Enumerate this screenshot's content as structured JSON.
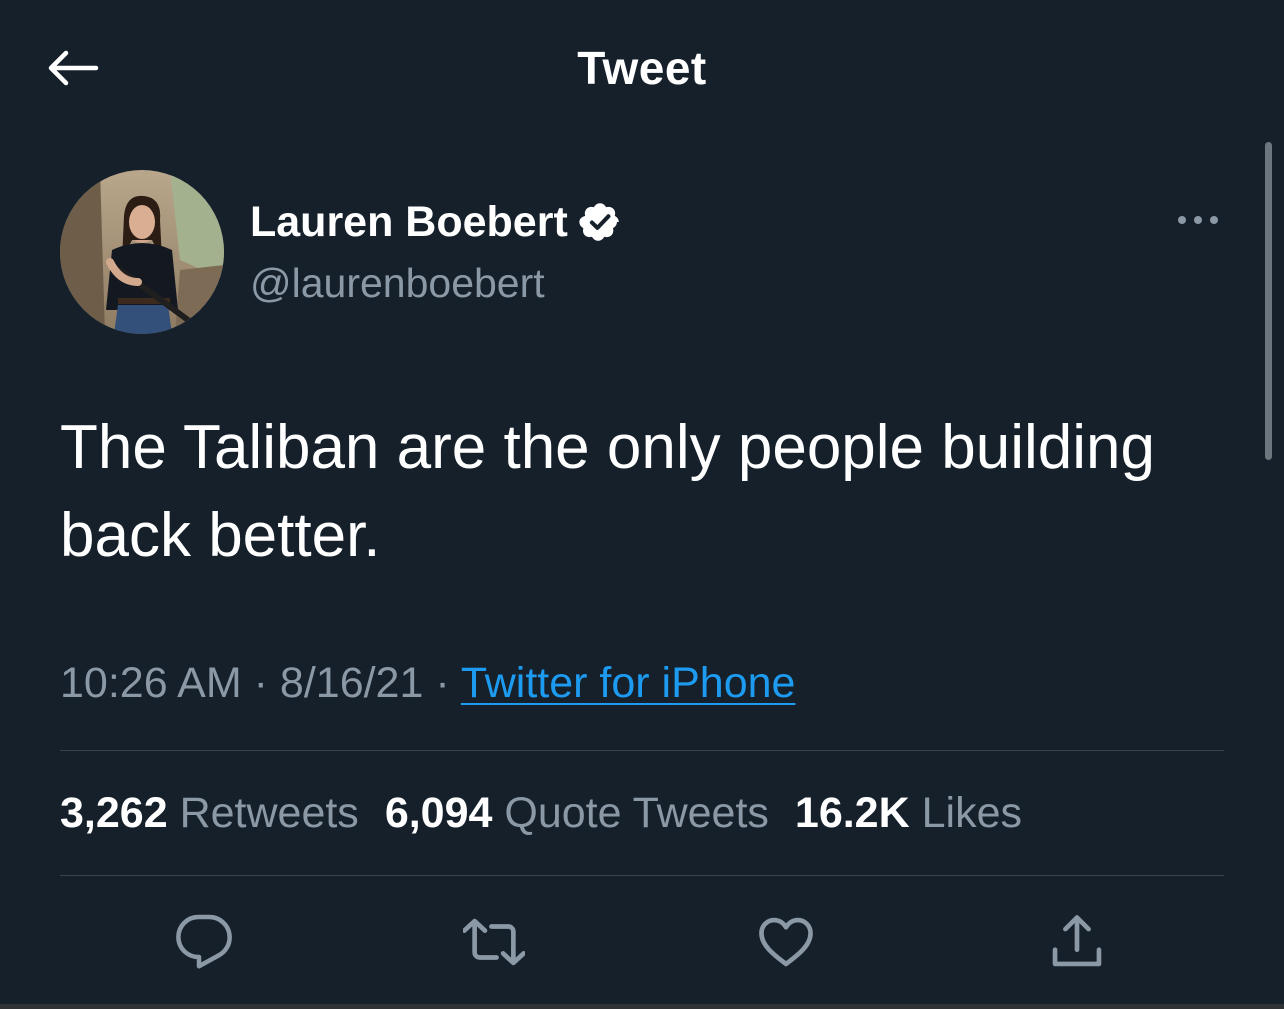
{
  "header": {
    "title": "Tweet",
    "back_icon": "back-arrow-icon"
  },
  "author": {
    "display_name": "Lauren Boebert",
    "handle": "@laurenboebert",
    "verified": true
  },
  "tweet": {
    "text": "The Taliban are the only people building\nback better.",
    "time": "10:26 AM",
    "date": "8/16/21",
    "separator": "·",
    "source": "Twitter for iPhone"
  },
  "stats": {
    "retweets_count": "3,262",
    "retweets_label": "Retweets",
    "quotes_count": "6,094",
    "quotes_label": "Quote Tweets",
    "likes_count": "16.2K",
    "likes_label": "Likes"
  },
  "actions": [
    "reply-icon",
    "retweet-icon",
    "like-icon",
    "share-icon"
  ],
  "colors": {
    "background": "#15202b",
    "text": "#ffffff",
    "secondary": "#8b98a5",
    "link": "#1d9bf0",
    "divider": "#38444d"
  }
}
